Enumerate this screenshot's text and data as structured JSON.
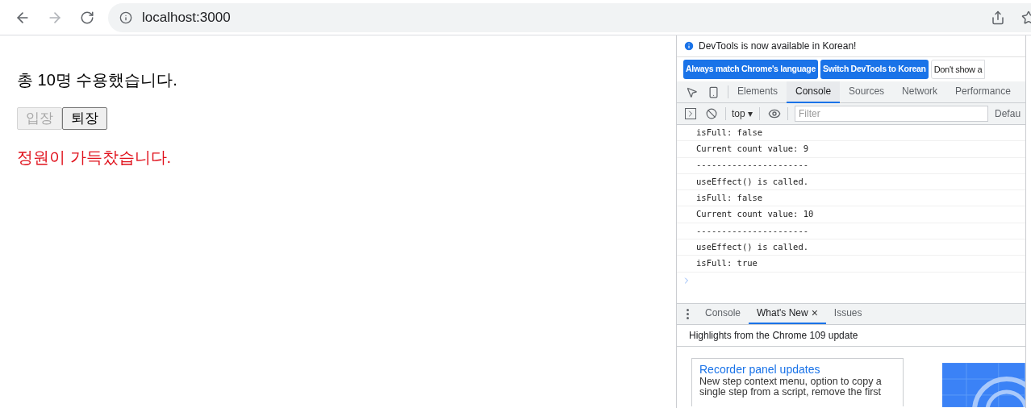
{
  "browser": {
    "url": "localhost:3000"
  },
  "page": {
    "heading": "총 10명 수용했습니다.",
    "buttons": [
      {
        "label": "입장",
        "disabled": true
      },
      {
        "label": "퇴장",
        "disabled": false
      }
    ],
    "message": "정원이 가득찼습니다."
  },
  "devtools": {
    "notice": "DevTools is now available in Korean!",
    "notice_buttons": [
      {
        "label": "Always match Chrome's language",
        "kind": "primary"
      },
      {
        "label": "Switch DevTools to Korean",
        "kind": "primary"
      },
      {
        "label": "Don't show a",
        "kind": "plain"
      }
    ],
    "tabs": [
      {
        "label": "Elements",
        "selected": false
      },
      {
        "label": "Console",
        "selected": true
      },
      {
        "label": "Sources",
        "selected": false
      },
      {
        "label": "Network",
        "selected": false
      },
      {
        "label": "Performance",
        "selected": false
      }
    ],
    "context": "top",
    "context_caret": "▾",
    "filter_placeholder": "Filter",
    "levels": "Defau",
    "console_lines": [
      "isFull: false",
      "Current count value: 9",
      "----------------------",
      "useEffect() is called.",
      "isFull: false",
      "Current count value: 10",
      "----------------------",
      "useEffect() is called.",
      "isFull: true"
    ],
    "drawer_tabs": [
      {
        "label": "Console",
        "selected": false,
        "closable": false
      },
      {
        "label": "What's New",
        "selected": true,
        "closable": true
      },
      {
        "label": "Issues",
        "selected": false,
        "closable": false
      }
    ],
    "close_glyph": "×",
    "highlights": "Highlights from the Chrome 109 update",
    "card": {
      "title": "Recorder panel updates",
      "body": "New step context menu, option to copy a single step from a script, remove the first"
    }
  }
}
